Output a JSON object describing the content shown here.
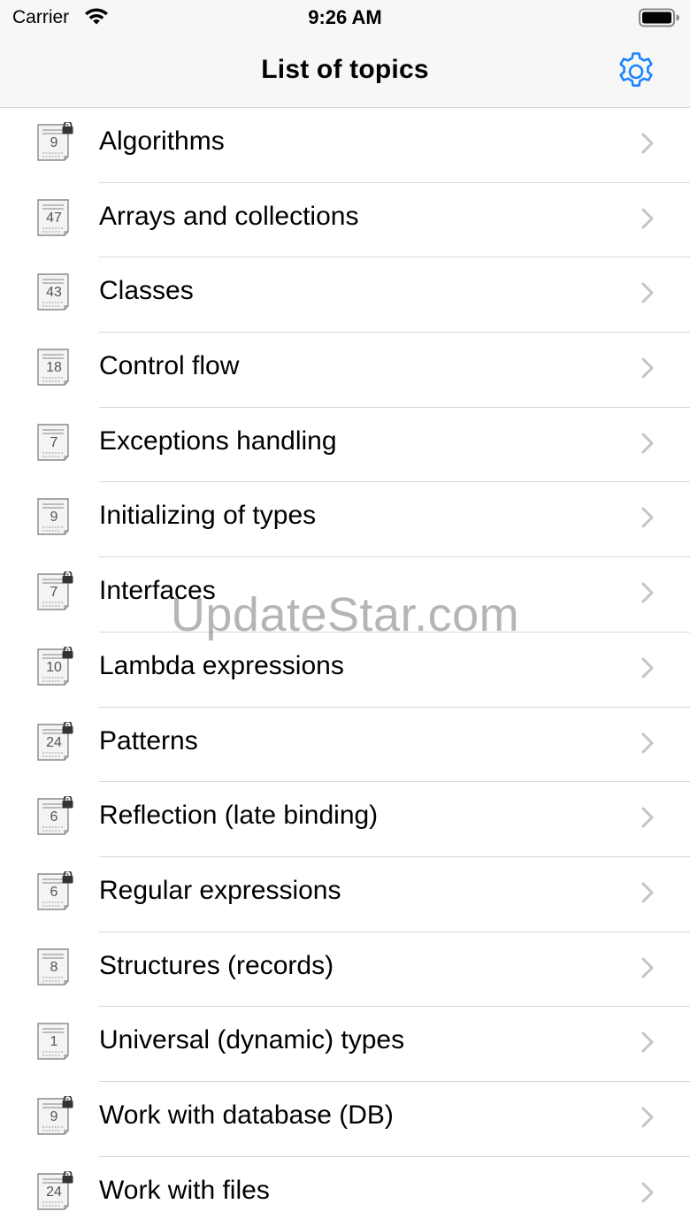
{
  "status_bar": {
    "carrier": "Carrier",
    "time": "9:26 AM",
    "wifi_icon": "wifi-icon",
    "battery_icon": "battery-icon"
  },
  "nav": {
    "title": "List of topics",
    "settings_icon": "gear-icon",
    "accent_color": "#1a84ff"
  },
  "topics": [
    {
      "label": "Algorithms",
      "count": "9",
      "locked": true
    },
    {
      "label": "Arrays and collections",
      "count": "47",
      "locked": false
    },
    {
      "label": "Classes",
      "count": "43",
      "locked": false
    },
    {
      "label": "Control flow",
      "count": "18",
      "locked": false
    },
    {
      "label": "Exceptions handling",
      "count": "7",
      "locked": false
    },
    {
      "label": "Initializing of types",
      "count": "9",
      "locked": false
    },
    {
      "label": "Interfaces",
      "count": "7",
      "locked": true
    },
    {
      "label": "Lambda expressions",
      "count": "10",
      "locked": true
    },
    {
      "label": "Patterns",
      "count": "24",
      "locked": true
    },
    {
      "label": "Reflection (late binding)",
      "count": "6",
      "locked": true
    },
    {
      "label": "Regular expressions",
      "count": "6",
      "locked": true
    },
    {
      "label": "Structures (records)",
      "count": "8",
      "locked": false
    },
    {
      "label": "Universal (dynamic) types",
      "count": "1",
      "locked": false
    },
    {
      "label": "Work with database (DB)",
      "count": "9",
      "locked": true
    },
    {
      "label": "Work with files",
      "count": "24",
      "locked": true
    }
  ],
  "watermark": "UpdateStar.com"
}
